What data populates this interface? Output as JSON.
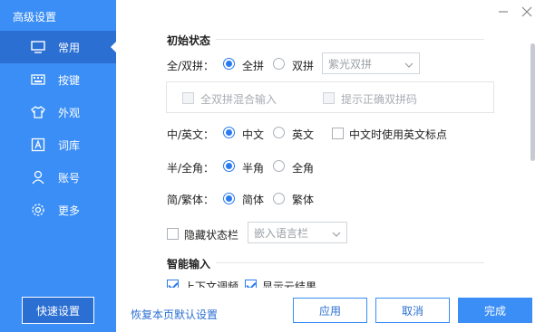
{
  "window": {
    "title": "高级设置"
  },
  "sidebar": {
    "items": [
      {
        "label": "常用",
        "icon": "monitor-icon"
      },
      {
        "label": "按键",
        "icon": "keyboard-icon"
      },
      {
        "label": "外观",
        "icon": "tshirt-icon"
      },
      {
        "label": "词库",
        "icon": "dictionary-icon"
      },
      {
        "label": "账号",
        "icon": "user-icon"
      },
      {
        "label": "更多",
        "icon": "gear-icon"
      }
    ],
    "active": "常用",
    "quick_setup": "快速设置"
  },
  "sections": {
    "initial_state": "初始状态",
    "smart_input": "智能输入"
  },
  "rows": {
    "pinyin": {
      "label": "全/双拼：",
      "opt1": "全拼",
      "opt2": "双拼",
      "selected": "全拼",
      "scheme": "紫光双拼",
      "mixed_input": "全双拼混合输入",
      "hint_correct": "提示正确双拼码"
    },
    "language": {
      "label": "中/英文：",
      "opt1": "中文",
      "opt2": "英文",
      "selected": "中文",
      "english_punct": "中文时使用英文标点"
    },
    "width": {
      "label": "半/全角：",
      "opt1": "半角",
      "opt2": "全角",
      "selected": "半角"
    },
    "script": {
      "label": "简/繁体：",
      "opt1": "简体",
      "opt2": "繁体",
      "selected": "简体"
    },
    "statusbar": {
      "hide_label": "隐藏状态栏",
      "embed": "嵌入语言栏"
    },
    "smart": {
      "context_tune": "上下文调频",
      "show_cloud": "显示云结果"
    }
  },
  "footer": {
    "restore": "恢复本页默认设置",
    "apply": "应用",
    "cancel": "取消",
    "finish": "完成"
  },
  "colors": {
    "sidebar_bg": "#3a8ef6",
    "sidebar_active": "#2b6fd3",
    "accent": "#2b7bef"
  }
}
